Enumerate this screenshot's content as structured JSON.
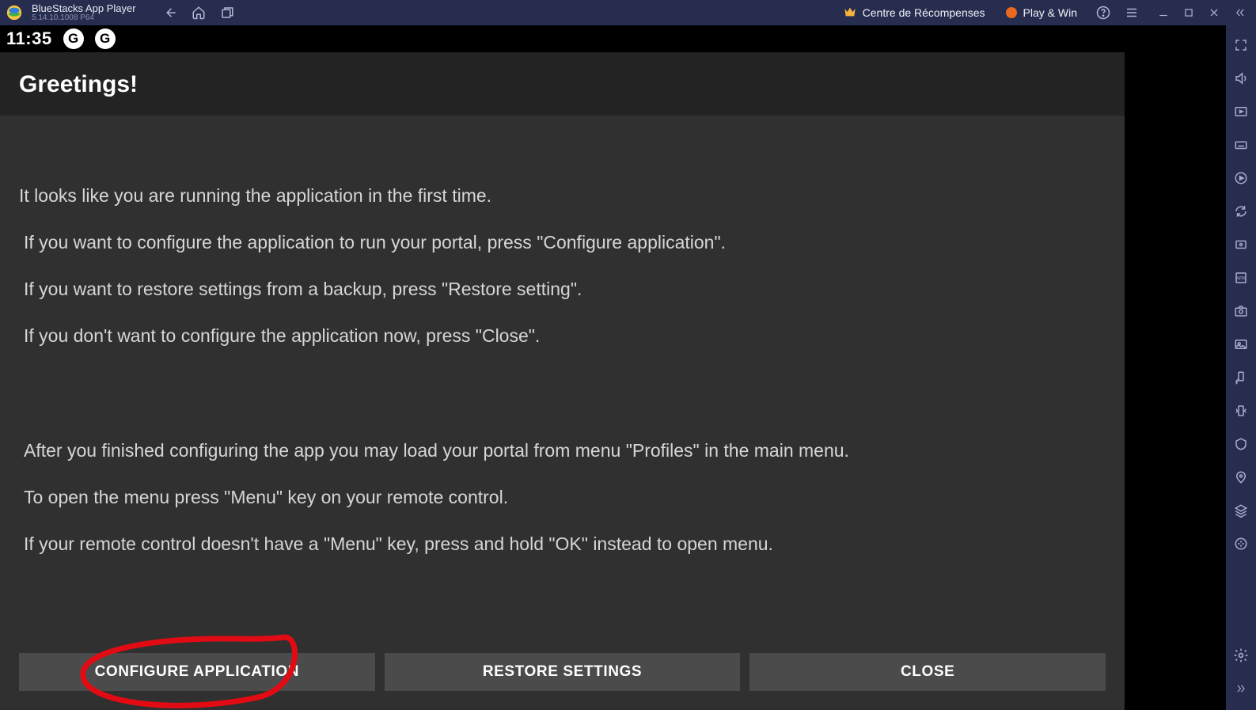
{
  "titlebar": {
    "app_name": "BlueStacks App Player",
    "version_line": "5.14.10.1008  P64",
    "rewards_label": "Centre de  Récompenses",
    "playwin_label": "Play & Win"
  },
  "statusbar": {
    "time": "11:35",
    "badge_letter": "G"
  },
  "content": {
    "heading": "Greetings!",
    "p1_l1": "It looks like you are running the application in the first time.",
    "p1_l2": " If you want to configure the application to run your portal, press \"Configure application\".",
    "p1_l3": " If you want to restore settings from a backup, press \"Restore setting\".",
    "p1_l4": " If you don't want to configure the application now, press \"Close\".",
    "p2_l1": " After you finished configuring the app you may load your portal from menu \"Profiles\" in the main menu.",
    "p2_l2": " To open the menu press \"Menu\" key on your remote control.",
    "p2_l3": " If your remote control doesn't have a \"Menu\" key, press and hold \"OK\" instead to open menu."
  },
  "buttons": {
    "configure": "CONFIGURE APPLICATION",
    "restore": "RESTORE SETTINGS",
    "close": "CLOSE"
  }
}
